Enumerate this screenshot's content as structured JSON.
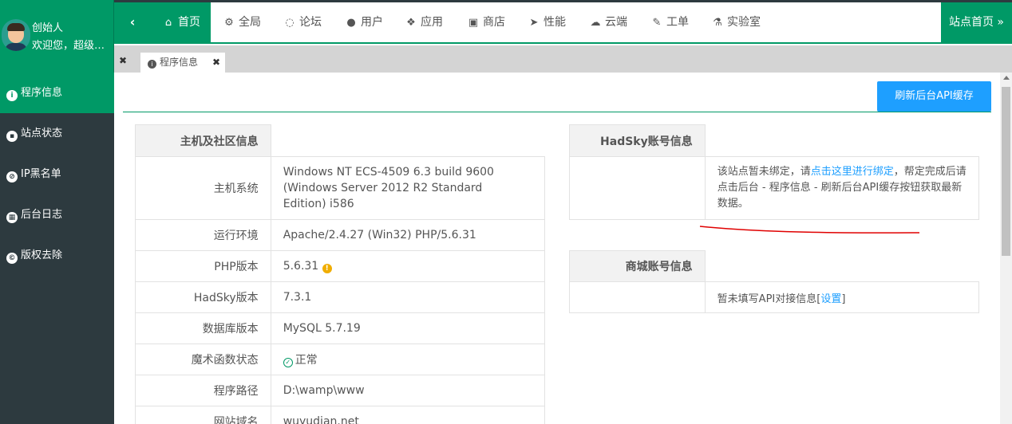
{
  "user": {
    "name": "创始人",
    "welcome": "欢迎您，超级管理员"
  },
  "nav": {
    "collapse_icon": "‹",
    "items": [
      {
        "label": "首页",
        "icon": "home-icon"
      },
      {
        "label": "全局",
        "icon": "cogs-icon"
      },
      {
        "label": "论坛",
        "icon": "comment-icon"
      },
      {
        "label": "用户",
        "icon": "users-icon"
      },
      {
        "label": "应用",
        "icon": "cubes-icon"
      },
      {
        "label": "商店",
        "icon": "shopping-bag-icon"
      },
      {
        "label": "性能",
        "icon": "paper-plane-icon"
      },
      {
        "label": "云端",
        "icon": "cloud-icon"
      },
      {
        "label": "工单",
        "icon": "wrench-icon"
      },
      {
        "label": "实验室",
        "icon": "flask-icon"
      }
    ],
    "site_home": "站点首页 »"
  },
  "sidebar": {
    "items": [
      {
        "label": "程序信息",
        "icon": "info-icon"
      },
      {
        "label": "站点状态",
        "icon": "lock-icon"
      },
      {
        "label": "IP黑名单",
        "icon": "ban-icon"
      },
      {
        "label": "后台日志",
        "icon": "calendar-icon"
      },
      {
        "label": "版权去除",
        "icon": "copyright-icon"
      }
    ]
  },
  "tabs": {
    "close_all": "✖",
    "active": "程序信息",
    "close": "✖"
  },
  "toolbar": {
    "refresh_label": "刷新后台API缓存"
  },
  "host_table": {
    "header": "主机及社区信息",
    "rows": [
      {
        "key": "主机系统",
        "value": "Windows NT ECS-4509 6.3 build 9600 (Windows Server 2012 R2 Standard Edition) i586"
      },
      {
        "key": "运行环境",
        "value": "Apache/2.4.27 (Win32) PHP/5.6.31"
      },
      {
        "key": "PHP版本",
        "value": "5.6.31"
      },
      {
        "key": "HadSky版本",
        "value": "7.3.1"
      },
      {
        "key": "数据库版本",
        "value": "MySQL 5.7.19"
      },
      {
        "key": "魔术函数状态",
        "value": "正常"
      },
      {
        "key": "程序路径",
        "value": "D:\\wamp\\www"
      },
      {
        "key": "网站域名",
        "value": "wuyudian.net"
      }
    ]
  },
  "hadsky_table": {
    "header": "HadSky账号信息",
    "text_before": "该站点暂未绑定，请",
    "link": "点击这里进行绑定",
    "text_after": "，帮定完成后请点击后台 - 程序信息 - 刷新后台API缓存按钮获取最新数据。"
  },
  "shop_table": {
    "header": "商城账号信息",
    "text": "暂未填写API对接信息[",
    "link": "设置",
    "text_end": "]"
  },
  "colors": {
    "brand": "#009966",
    "dark": "#2d3a3f",
    "button": "#1e9fff",
    "annotation": "#e00000"
  }
}
